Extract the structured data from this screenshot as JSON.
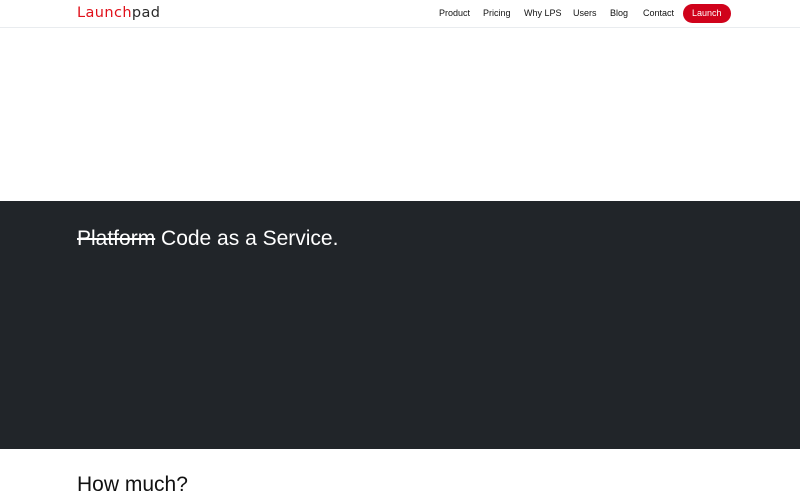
{
  "brand": {
    "part1": "Launch",
    "part2": "pad"
  },
  "nav": {
    "product": "Product",
    "pricing": "Pricing",
    "why": "Why LPS",
    "users": "Users",
    "blog": "Blog",
    "contact": "Contact",
    "launch": "Launch"
  },
  "hero": {
    "struck": "Platform",
    "rest": " Code as a Service."
  },
  "pricing_section": {
    "heading": "How much?"
  },
  "colors": {
    "accent": "#d0021b",
    "dark_band": "#212529"
  }
}
